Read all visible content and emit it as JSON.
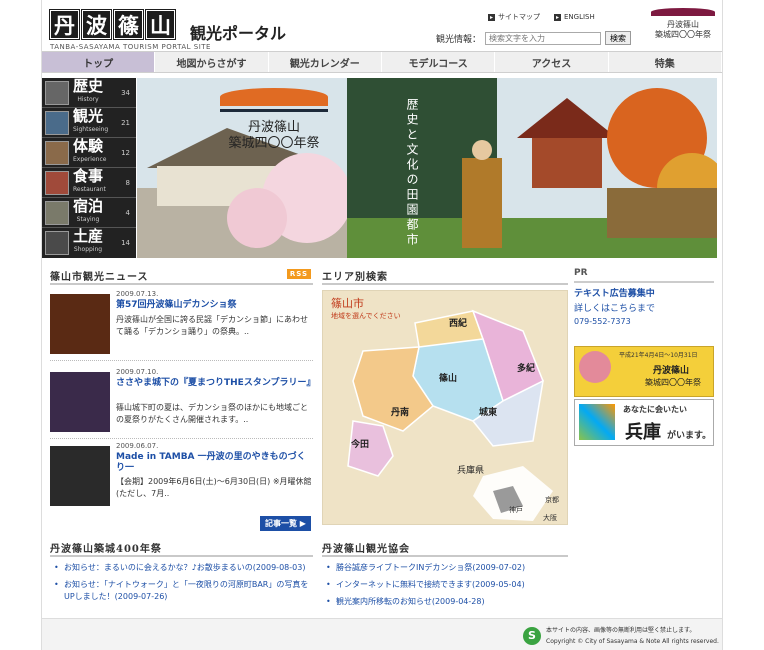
{
  "header": {
    "logo_chars": [
      "丹",
      "波",
      "篠",
      "山"
    ],
    "logo_suffix": "観光ポータル",
    "logo_en": "TANBA-SASAYAMA TOURISM PORTAL SITE",
    "sitemap": "サイトマップ",
    "english": "ENGLISH",
    "search_label": "観光情報：",
    "search_placeholder": "検索文字を入力",
    "search_button": "検索",
    "badge_line1": "丹波篠山",
    "badge_line2": "築城四〇〇年祭"
  },
  "nav": {
    "items": [
      "トップ",
      "地図からさがす",
      "観光カレンダー",
      "モデルコース",
      "アクセス",
      "特集"
    ],
    "active_index": 0
  },
  "menu": {
    "items": [
      {
        "jp": "歴史",
        "en": "History",
        "count": "34"
      },
      {
        "jp": "観光",
        "en": "Sightseeing",
        "count": "21"
      },
      {
        "jp": "体験",
        "en": "Experience",
        "count": "12"
      },
      {
        "jp": "食事",
        "en": "Restaurant",
        "count": "8"
      },
      {
        "jp": "宿泊",
        "en": "Staying",
        "count": "4"
      },
      {
        "jp": "土産",
        "en": "Shopping",
        "count": "14"
      }
    ]
  },
  "hero": {
    "line1": "丹波篠山",
    "line2": "築城四〇〇年祭",
    "vertical": "歴史と文化の田園都市"
  },
  "news": {
    "title": "篠山市観光ニュース",
    "rss": "RSS",
    "items": [
      {
        "date": "2009.07.13.",
        "title": "第57回丹波篠山デカンショ祭",
        "body": "丹波篠山が全国に誇る民謡「デカンショ節」にあわせて踊る「デカンショ踊り」の祭典。.."
      },
      {
        "date": "2009.07.10.",
        "title": "ささやま城下の『夏まつりTHEスタンプラリー』",
        "body": "篠山城下町の夏は、デカンショ祭のほかにも地域ごとの夏祭りがたくさん開催されます。.."
      },
      {
        "date": "2009.06.07.",
        "title": "Made in TAMBA 一丹波の里のやきものづくり一",
        "body": "【会期】2009年6月6日(土)〜6月30日(日) ※月曜休館(ただし、7月.."
      }
    ],
    "more": "記事一覧 ▶"
  },
  "area": {
    "title": "エリア別検索",
    "map_title": "篠山市",
    "map_sub": "地域を選んでください",
    "regions": [
      "西紀",
      "多紀",
      "篠山",
      "丹南",
      "城東",
      "今田"
    ],
    "prefecture": "兵庫県",
    "cities": [
      "京都",
      "神戸",
      "大阪"
    ]
  },
  "pr": {
    "title": "PR",
    "link": "テキスト広告募集中",
    "link2": "詳しくはこちらまで",
    "tel": "079-552-7373",
    "banner1_text": "平成21年4月4日〜10月31日",
    "banner1_sub": "丹波篠山",
    "banner1_sub2": "築城四〇〇年祭",
    "banner2_text": "あなたに会いたい",
    "banner2_big": "兵庫",
    "banner2_tail": "がいます。"
  },
  "festival": {
    "title": "丹波篠山築城400年祭",
    "items": [
      "お知らせ：まるいのに会えるかな？♪お散歩まるいの(2009-08-03)",
      "お知らせ：「ナイトウォーク」と「一夜限りの河原町BAR」の写真をUPしました！(2009-07-26)"
    ]
  },
  "association": {
    "title": "丹波篠山観光協会",
    "items": [
      "勝谷誠彦ライブトークINデカンショ祭(2009-07-02)",
      "インターネットに無料で接続できます(2009-05-04)",
      "観光案内所移転のお知らせ(2009-04-28)"
    ]
  },
  "footer": {
    "line1": "本サイトの内容、画像等の無断利用は堅く禁止します。",
    "line2": "Copyright © City of Sasayama & Note All rights reserved."
  }
}
